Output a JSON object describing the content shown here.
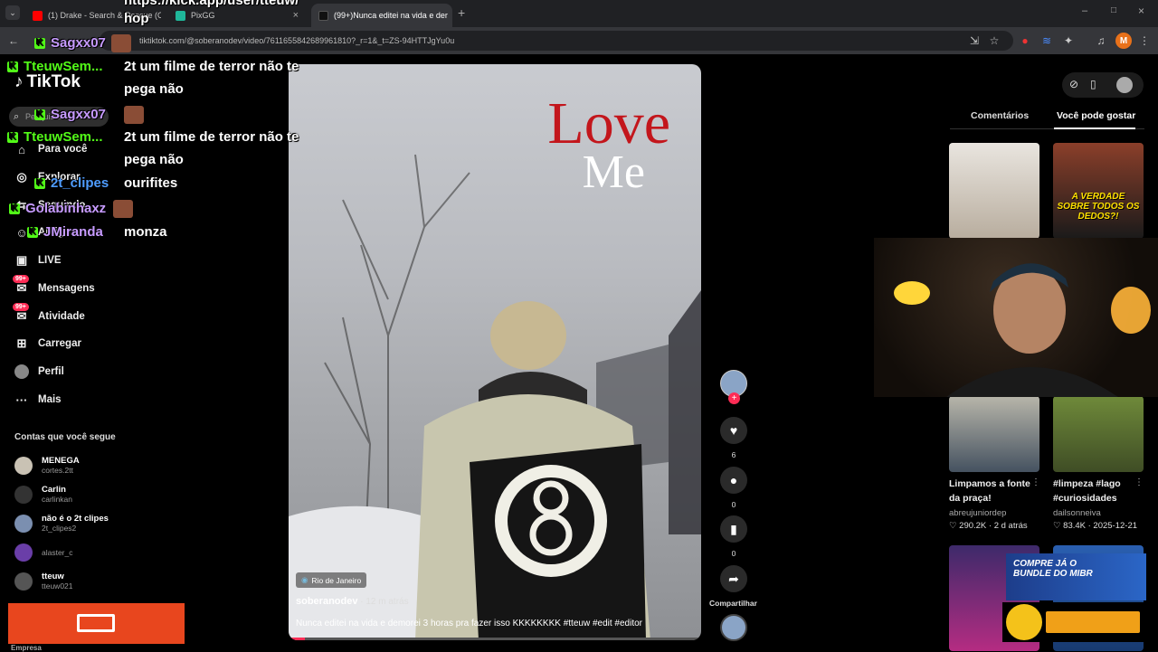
{
  "browser": {
    "tabs": [
      {
        "title": "(1) Drake - Search & Rescue (O"
      },
      {
        "title": "PixGG"
      },
      {
        "title": "(99+)Nunca editei na vida e der"
      }
    ],
    "url": "tiktok.com/@soberanodev/video/7611655842689961810?_r=1&_t=ZS-94HTTJgYu0u",
    "url_prefix": "tik",
    "new_tab": "+",
    "profile_letter": "M"
  },
  "tiktok": {
    "logo": "TikTok",
    "search_placeholder": "Pesquisar",
    "nav": [
      {
        "label": "Para você",
        "icon": "home-icon"
      },
      {
        "label": "Explorar",
        "icon": "compass-icon"
      },
      {
        "label": "Seguindo",
        "icon": "following-icon"
      },
      {
        "label": "Amigos",
        "icon": "friends-icon"
      },
      {
        "label": "LIVE",
        "icon": "live-icon"
      },
      {
        "label": "Mensagens",
        "icon": "messages-icon",
        "badge": "99+"
      },
      {
        "label": "Atividade",
        "icon": "activity-icon",
        "badge": "99+"
      },
      {
        "label": "Carregar",
        "icon": "upload-icon"
      },
      {
        "label": "Perfil",
        "icon": "profile-icon"
      },
      {
        "label": "Mais",
        "icon": "more-icon"
      }
    ],
    "following_title": "Contas que você segue",
    "following": [
      {
        "name": "MENEGA",
        "handle": "cortes.2tt"
      },
      {
        "name": "Carlin",
        "handle": "carlinkan"
      },
      {
        "name": "não é o 2t clipes",
        "handle": "2t_clipes2"
      },
      {
        "name": "",
        "handle": "alaster_c"
      },
      {
        "name": "tteuw",
        "handle": "tteuw021"
      }
    ],
    "footer": "Empresa"
  },
  "video": {
    "overlay_line1": "Love",
    "overlay_line2": "Me",
    "location": "Rio de Janeiro",
    "author": "soberanodev",
    "time": " · 12 m atrás",
    "caption": "Nunca editei na vida e demorei 3 horas pra fazer isso KKKKKKKK #tteuw #edit #editor",
    "likes": "6",
    "comments": "0",
    "saves": "0",
    "share_label": "Compartilhar"
  },
  "right": {
    "tab_comments": "Comentários",
    "tab_suggest": "Você pode gostar",
    "thumb_texts": [
      "A VERDADE SOBRE TODOS OS DEDOS?!"
    ],
    "videos": [
      {
        "title": "Limpamos a fonte da praça!",
        "author": "abreujuniordep",
        "stats": "♡ 290.2K · 2 d atrás"
      },
      {
        "title": "#limpeza #lago #curiosidades",
        "author": "dailsonneiva",
        "stats": "♡ 83.4K · 2025-12-21"
      }
    ]
  },
  "chat": [
    {
      "user": "hop",
      "msg": "",
      "color": "#ffffff"
    },
    {
      "user": "Sagxx07",
      "msg": "",
      "color": "#c79bff"
    },
    {
      "user": "TteuwSem...",
      "msg": "2t um filme de terror não te",
      "color": "#53fc18"
    },
    {
      "user": "",
      "msg": "pega não",
      "color": "#ffffff"
    },
    {
      "user": "Sagxx07",
      "msg": "",
      "color": "#c79bff"
    },
    {
      "user": "TteuwSem...",
      "msg": "2t um filme de terror não te",
      "color": "#53fc18"
    },
    {
      "user": "",
      "msg": "pega não",
      "color": "#ffffff"
    },
    {
      "user": "2t_clipes",
      "msg": "ourifites",
      "color": "#4f9dff"
    },
    {
      "user": "Golabinhaxz",
      "msg": "",
      "color": "#c79bff"
    },
    {
      "user": "JMiranda",
      "msg": "monza",
      "color": "#c79bff"
    }
  ],
  "overlay_texts": {
    "mibr": "COMPRE JÁ O BUNDLE DO MIBR",
    "url_overlay": "https://kick.app/user/tteuw/"
  }
}
